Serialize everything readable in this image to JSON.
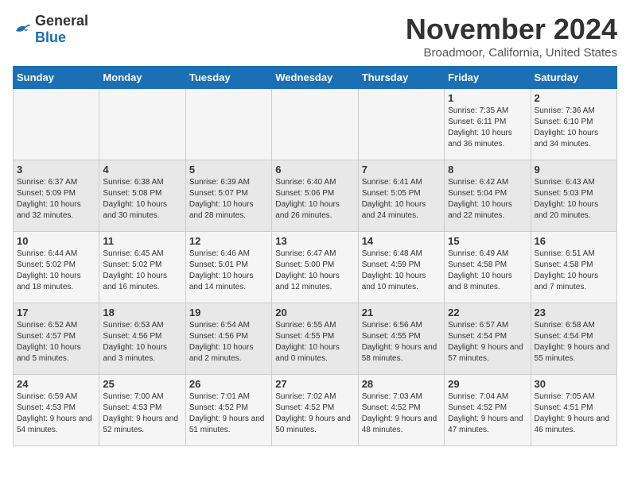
{
  "logo": {
    "general": "General",
    "blue": "Blue"
  },
  "header": {
    "month": "November 2024",
    "location": "Broadmoor, California, United States"
  },
  "days_of_week": [
    "Sunday",
    "Monday",
    "Tuesday",
    "Wednesday",
    "Thursday",
    "Friday",
    "Saturday"
  ],
  "weeks": [
    [
      {
        "day": "",
        "content": ""
      },
      {
        "day": "",
        "content": ""
      },
      {
        "day": "",
        "content": ""
      },
      {
        "day": "",
        "content": ""
      },
      {
        "day": "",
        "content": ""
      },
      {
        "day": "1",
        "content": "Sunrise: 7:35 AM\nSunset: 6:11 PM\nDaylight: 10 hours and 36 minutes."
      },
      {
        "day": "2",
        "content": "Sunrise: 7:36 AM\nSunset: 6:10 PM\nDaylight: 10 hours and 34 minutes."
      }
    ],
    [
      {
        "day": "3",
        "content": "Sunrise: 6:37 AM\nSunset: 5:09 PM\nDaylight: 10 hours and 32 minutes."
      },
      {
        "day": "4",
        "content": "Sunrise: 6:38 AM\nSunset: 5:08 PM\nDaylight: 10 hours and 30 minutes."
      },
      {
        "day": "5",
        "content": "Sunrise: 6:39 AM\nSunset: 5:07 PM\nDaylight: 10 hours and 28 minutes."
      },
      {
        "day": "6",
        "content": "Sunrise: 6:40 AM\nSunset: 5:06 PM\nDaylight: 10 hours and 26 minutes."
      },
      {
        "day": "7",
        "content": "Sunrise: 6:41 AM\nSunset: 5:05 PM\nDaylight: 10 hours and 24 minutes."
      },
      {
        "day": "8",
        "content": "Sunrise: 6:42 AM\nSunset: 5:04 PM\nDaylight: 10 hours and 22 minutes."
      },
      {
        "day": "9",
        "content": "Sunrise: 6:43 AM\nSunset: 5:03 PM\nDaylight: 10 hours and 20 minutes."
      }
    ],
    [
      {
        "day": "10",
        "content": "Sunrise: 6:44 AM\nSunset: 5:02 PM\nDaylight: 10 hours and 18 minutes."
      },
      {
        "day": "11",
        "content": "Sunrise: 6:45 AM\nSunset: 5:02 PM\nDaylight: 10 hours and 16 minutes."
      },
      {
        "day": "12",
        "content": "Sunrise: 6:46 AM\nSunset: 5:01 PM\nDaylight: 10 hours and 14 minutes."
      },
      {
        "day": "13",
        "content": "Sunrise: 6:47 AM\nSunset: 5:00 PM\nDaylight: 10 hours and 12 minutes."
      },
      {
        "day": "14",
        "content": "Sunrise: 6:48 AM\nSunset: 4:59 PM\nDaylight: 10 hours and 10 minutes."
      },
      {
        "day": "15",
        "content": "Sunrise: 6:49 AM\nSunset: 4:58 PM\nDaylight: 10 hours and 8 minutes."
      },
      {
        "day": "16",
        "content": "Sunrise: 6:51 AM\nSunset: 4:58 PM\nDaylight: 10 hours and 7 minutes."
      }
    ],
    [
      {
        "day": "17",
        "content": "Sunrise: 6:52 AM\nSunset: 4:57 PM\nDaylight: 10 hours and 5 minutes."
      },
      {
        "day": "18",
        "content": "Sunrise: 6:53 AM\nSunset: 4:56 PM\nDaylight: 10 hours and 3 minutes."
      },
      {
        "day": "19",
        "content": "Sunrise: 6:54 AM\nSunset: 4:56 PM\nDaylight: 10 hours and 2 minutes."
      },
      {
        "day": "20",
        "content": "Sunrise: 6:55 AM\nSunset: 4:55 PM\nDaylight: 10 hours and 0 minutes."
      },
      {
        "day": "21",
        "content": "Sunrise: 6:56 AM\nSunset: 4:55 PM\nDaylight: 9 hours and 58 minutes."
      },
      {
        "day": "22",
        "content": "Sunrise: 6:57 AM\nSunset: 4:54 PM\nDaylight: 9 hours and 57 minutes."
      },
      {
        "day": "23",
        "content": "Sunrise: 6:58 AM\nSunset: 4:54 PM\nDaylight: 9 hours and 55 minutes."
      }
    ],
    [
      {
        "day": "24",
        "content": "Sunrise: 6:59 AM\nSunset: 4:53 PM\nDaylight: 9 hours and 54 minutes."
      },
      {
        "day": "25",
        "content": "Sunrise: 7:00 AM\nSunset: 4:53 PM\nDaylight: 9 hours and 52 minutes."
      },
      {
        "day": "26",
        "content": "Sunrise: 7:01 AM\nSunset: 4:52 PM\nDaylight: 9 hours and 51 minutes."
      },
      {
        "day": "27",
        "content": "Sunrise: 7:02 AM\nSunset: 4:52 PM\nDaylight: 9 hours and 50 minutes."
      },
      {
        "day": "28",
        "content": "Sunrise: 7:03 AM\nSunset: 4:52 PM\nDaylight: 9 hours and 48 minutes."
      },
      {
        "day": "29",
        "content": "Sunrise: 7:04 AM\nSunset: 4:52 PM\nDaylight: 9 hours and 47 minutes."
      },
      {
        "day": "30",
        "content": "Sunrise: 7:05 AM\nSunset: 4:51 PM\nDaylight: 9 hours and 46 minutes."
      }
    ]
  ]
}
